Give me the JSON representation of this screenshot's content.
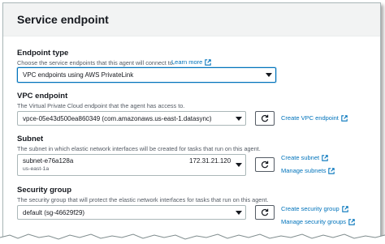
{
  "section": {
    "title": "Service endpoint"
  },
  "endpoint_type": {
    "label": "Endpoint type",
    "description": "Choose the service endpoints that this agent will connect to.",
    "learn_more": "Learn more",
    "selected": "VPC endpoints using AWS PrivateLink"
  },
  "vpc_endpoint": {
    "label": "VPC endpoint",
    "description": "The Virtual Private Cloud endpoint that the agent has access to.",
    "selected": "vpce-05e43d500ea860349 (com.amazonaws.us-east-1.datasync)",
    "create_link": "Create VPC endpoint"
  },
  "subnet": {
    "label": "Subnet",
    "description": "The subnet in which elastic network interfaces will be created for tasks that run on this agent.",
    "selected": "subnet-e76a128a",
    "selected_zone": "us-east-1a",
    "selected_cidr": "172.31.21.120",
    "create_link": "Create subnet",
    "manage_link": "Manage subnets"
  },
  "security_group": {
    "label": "Security group",
    "description": "The security group that will protect the elastic network interfaces for tasks that run on this agent.",
    "selected": "default (sg-46629f29)",
    "create_link": "Create security group",
    "manage_link": "Manage security groups"
  },
  "colors": {
    "link": "#0073bb",
    "focus_border": "#0073bb",
    "header_bg": "#f2f3f3"
  },
  "icons": [
    "external-link-icon",
    "refresh-icon",
    "caret-down-icon"
  ]
}
